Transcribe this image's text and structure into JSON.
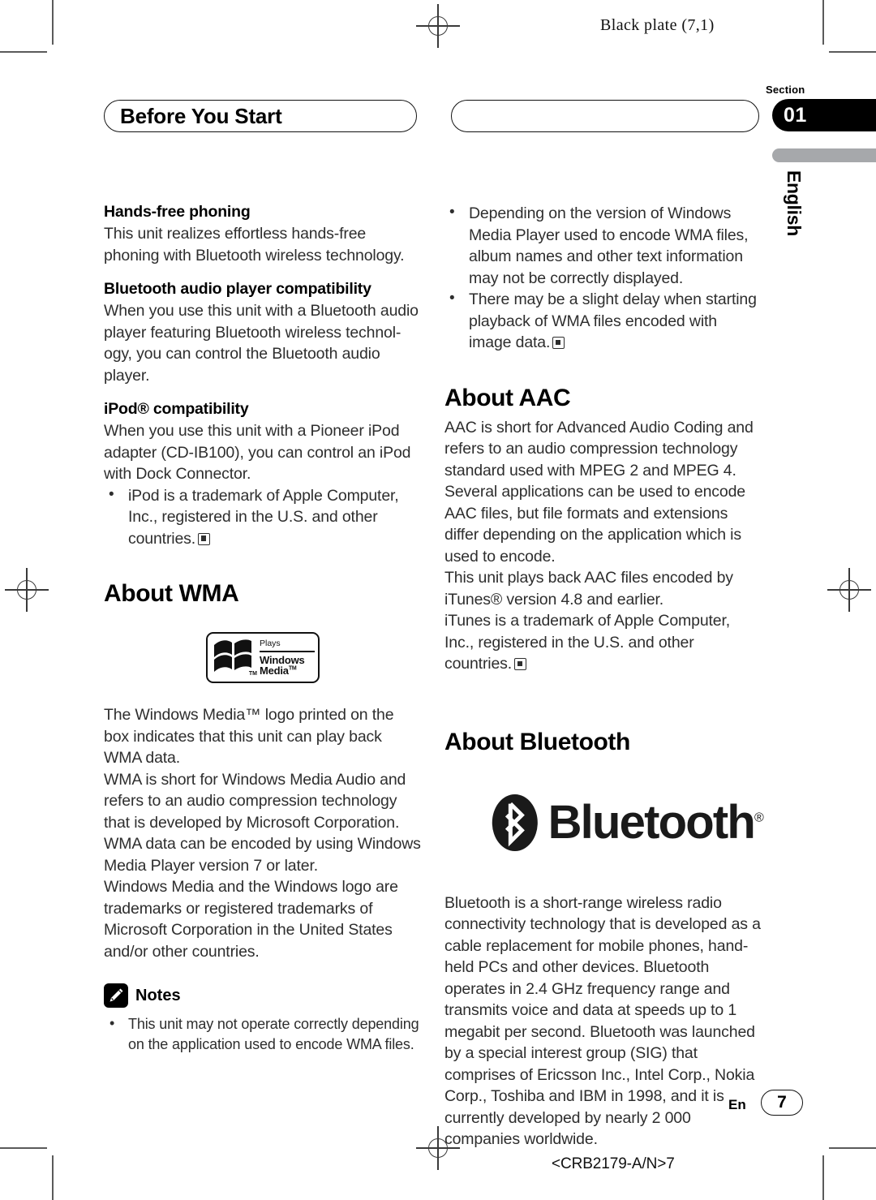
{
  "print_marks": {
    "plate_label": "Black plate (7,1)",
    "doc_code": "<CRB2179-A/N>7"
  },
  "header": {
    "title_left": "Before You Start",
    "title_right": "",
    "section_word": "Section",
    "section_number": "01",
    "language_tab": "English",
    "accent_black": "#000000",
    "accent_gray": "#a6a8ab"
  },
  "left_column": {
    "sub1_title": "Hands-free phoning",
    "sub1_body": "This unit realizes effortless hands-free phoning with Bluetooth wireless technology.",
    "sub2_title": "Bluetooth audio player compatibility",
    "sub2_body": "When you use this unit with a Bluetooth audio player featuring Bluetooth wireless technol-ogy, you can control the Bluetooth audio player.",
    "sub3_title": "iPod® compatibility",
    "sub3_body": "When you use this unit with a Pioneer iPod adapter (CD-IB100), you can control an iPod with Dock Connector.",
    "sub3_bullet": "iPod is a trademark of Apple Computer, Inc., registered in the U.S. and other countries.",
    "wma_heading": "About WMA",
    "wma_logo": {
      "plays": "Plays",
      "windows": "Windows",
      "media": "Media",
      "media_tm": "TM",
      "flag_tm": "TM"
    },
    "wma_para1": "The Windows Media™ logo printed on the box indicates that this unit can play back WMA data.",
    "wma_para2": "WMA is short for Windows Media Audio and refers to an audio compression technology that is developed by Microsoft Corporation. WMA data can be encoded by using Windows Media Player version 7 or later.",
    "wma_para3": "Windows Media and the Windows logo are trademarks or registered trademarks of Microsoft Corporation in the United States and/or other countries.",
    "notes_label": "Notes",
    "notes_items": [
      "This unit may not operate correctly depending on the application used to encode WMA files."
    ]
  },
  "right_column": {
    "top_bullets": [
      "Depending on the version of Windows Media Player used to encode WMA files, album names and other text information may not be correctly displayed.",
      "There may be a slight delay when starting playback of WMA files encoded with image data."
    ],
    "aac_heading": "About AAC",
    "aac_para1": "AAC is short for Advanced Audio Coding and refers to an audio compression technology standard used with MPEG 2 and MPEG 4. Several applications can be used to encode AAC files, but file formats and extensions differ depending on the application which is used to encode.",
    "aac_para2": "This unit plays back AAC files encoded by iTunes® version 4.8 and earlier.",
    "aac_para3": "iTunes is a trademark of Apple Computer, Inc., registered in the U.S. and other countries.",
    "bluetooth_heading": "About Bluetooth",
    "bluetooth_wordmark": "Bluetooth",
    "bluetooth_registered": "®",
    "bluetooth_body": "Bluetooth is a short-range wireless radio connectivity technology that is developed as a cable replacement for mobile phones, hand-held PCs and other devices. Bluetooth operates in 2.4 GHz frequency range and transmits voice and data at speeds up to 1 megabit per second. Bluetooth was launched by a special interest group (SIG) that comprises of Ericsson Inc., Intel Corp., Nokia Corp., Toshiba and IBM in 1998, and it is currently developed by nearly 2 000 companies worldwide."
  },
  "footer": {
    "language_code": "En",
    "page_number": "7"
  }
}
